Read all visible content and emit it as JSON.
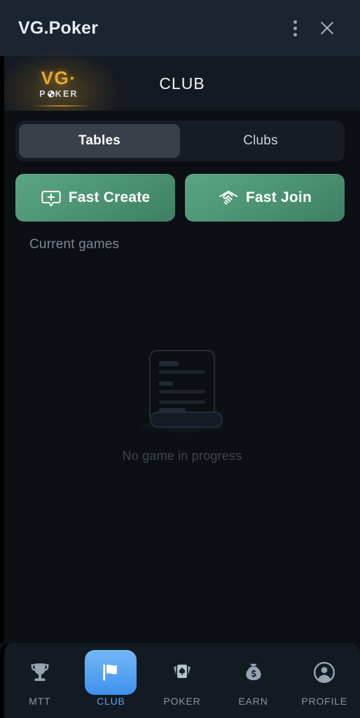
{
  "window": {
    "title": "VG.Poker",
    "menu_icon": "kebab-menu-icon",
    "close_icon": "close-icon"
  },
  "header": {
    "logo_primary": "VG",
    "logo_dot": "·",
    "logo_secondary_left": "P",
    "logo_secondary_right": "KER",
    "logo_chip_icon": "poker-chip-icon",
    "title": "CLUB"
  },
  "tabs": {
    "items": [
      {
        "label": "Tables",
        "active": true
      },
      {
        "label": "Clubs",
        "active": false
      }
    ]
  },
  "actions": [
    {
      "label": "Fast Create",
      "icon": "speech-bubble-plus-icon"
    },
    {
      "label": "Fast Join",
      "icon": "handshake-icon"
    }
  ],
  "main": {
    "section_label": "Current games",
    "empty_state": {
      "icon": "document-scroll-icon",
      "text": "No game in progress"
    }
  },
  "bottom_nav": {
    "items": [
      {
        "label": "MTT",
        "icon": "trophy-icon",
        "active": false
      },
      {
        "label": "CLUB",
        "icon": "flag-icon",
        "active": true
      },
      {
        "label": "POKER",
        "icon": "playing-cards-icon",
        "active": false
      },
      {
        "label": "EARN",
        "icon": "money-bag-icon",
        "active": false
      },
      {
        "label": "PROFILE",
        "icon": "person-circle-icon",
        "active": false
      }
    ]
  },
  "colors": {
    "titlebar_bg": "#1b2430",
    "header_bg": "#151a22",
    "content_bg": "#0c0f14",
    "nav_bg": "#141a22",
    "accent_gold": "#e9a92a",
    "accent_green": "#4f9878",
    "accent_blue": "#3f91ee",
    "active_tab_bg": "#3a4049"
  }
}
